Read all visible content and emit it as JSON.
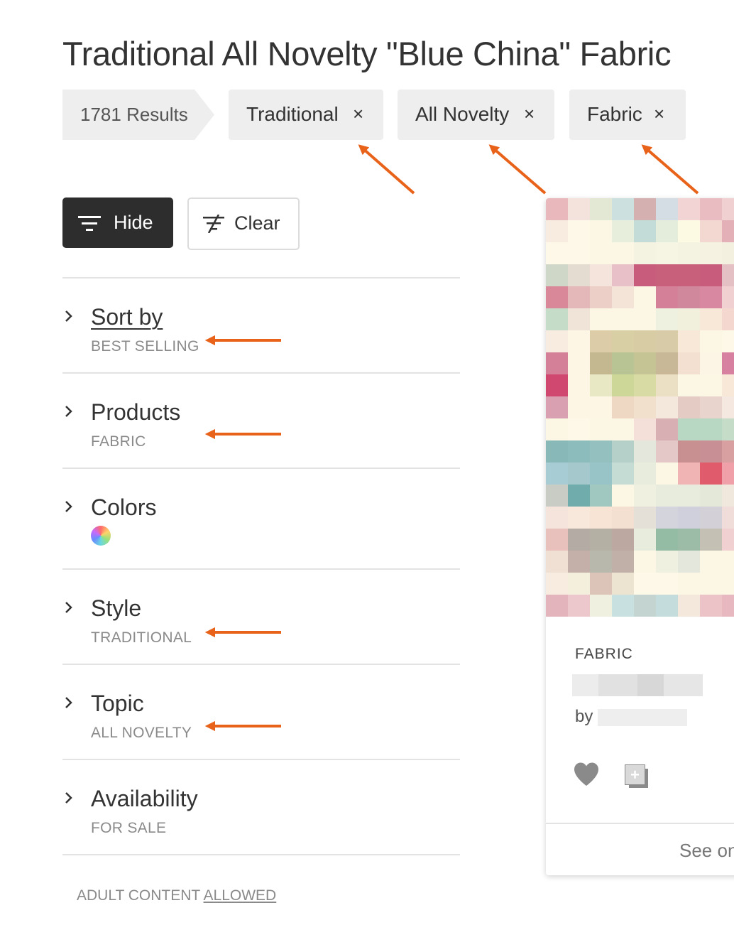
{
  "page": {
    "title": "Traditional All Novelty \"Blue China\" Fabric"
  },
  "results": {
    "label": "1781 Results"
  },
  "filter_chips": [
    {
      "label": "Traditional",
      "remove": "×"
    },
    {
      "label": "All Novelty",
      "remove": "×"
    },
    {
      "label": "Fabric",
      "remove": "×"
    }
  ],
  "toolbar": {
    "hide_label": "Hide",
    "clear_label": "Clear"
  },
  "filters": {
    "sort": {
      "title": "Sort by",
      "value": "BEST SELLING"
    },
    "products": {
      "title": "Products",
      "value": "FABRIC"
    },
    "colors": {
      "title": "Colors"
    },
    "style": {
      "title": "Style",
      "value": "TRADITIONAL"
    },
    "topic": {
      "title": "Topic",
      "value": "ALL NOVELTY"
    },
    "availability": {
      "title": "Availability",
      "value": "FOR SALE"
    }
  },
  "adult_content": {
    "prefix": "ADULT CONTENT ",
    "link": "ALLOWED"
  },
  "product_card": {
    "type_label": "FABRIC",
    "by_label": "by",
    "see_more": "See on",
    "icons": [
      "heart-icon",
      "add-to-collection-icon"
    ]
  },
  "annotation_color": "#e8621a"
}
